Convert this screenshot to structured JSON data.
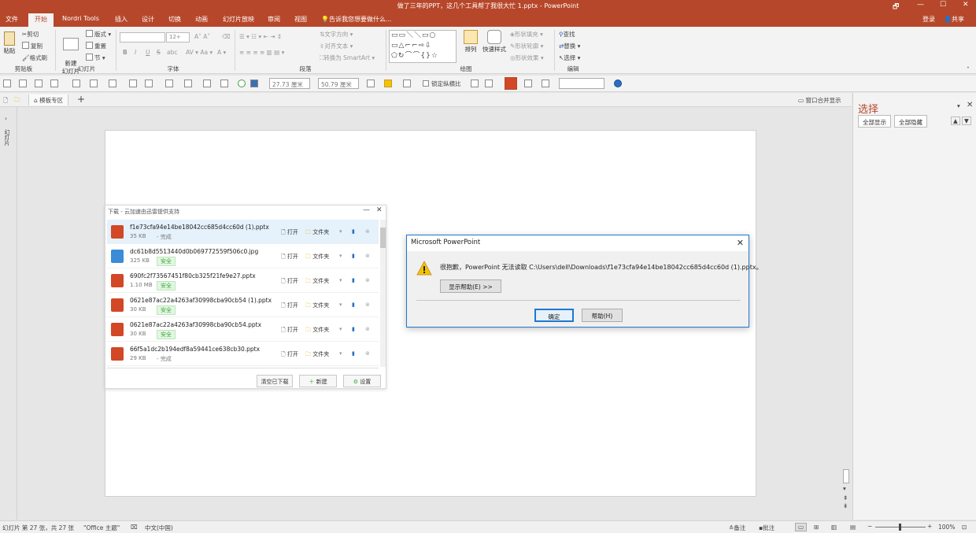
{
  "app": {
    "title": "做了三年的PPT，这几个工具帮了我很大忙 1.pptx - PowerPoint",
    "window_controls": [
      "🗗",
      "—",
      "☐",
      "✕"
    ]
  },
  "tabs": [
    {
      "label": "文件"
    },
    {
      "label": "开始",
      "active": true
    },
    {
      "label": "Nordri Tools"
    },
    {
      "label": "插入"
    },
    {
      "label": "设计"
    },
    {
      "label": "切换"
    },
    {
      "label": "动画"
    },
    {
      "label": "幻灯片放映"
    },
    {
      "label": "审阅"
    },
    {
      "label": "视图"
    }
  ],
  "tell_me": "告诉我您想要做什么...",
  "account": {
    "login": "登录",
    "share": "共享"
  },
  "ribbon": {
    "clipboard": {
      "paste": "粘贴",
      "cut": "剪切",
      "copy": "复制",
      "format_painter": "格式刷",
      "group": "剪贴板"
    },
    "slides": {
      "new_slide": "新建\n幻灯片",
      "layout": "版式",
      "reset": "重置",
      "section": "节",
      "group": "幻灯片"
    },
    "font": {
      "size": "12+",
      "bold": "B",
      "italic": "I",
      "underline": "U",
      "strike": "S",
      "shadow": "abc",
      "group": "字体"
    },
    "paragraph": {
      "text_dir": "文字方向",
      "align_text": "对齐文本",
      "smartart": "转换为 SmartArt",
      "group": "段落"
    },
    "drawing": {
      "arrange": "排列",
      "quick_styles": "快速样式",
      "fill": "形状填充",
      "outline": "形状轮廓",
      "effects": "形状效果",
      "group": "绘图"
    },
    "editing": {
      "find": "查找",
      "replace": "替换",
      "select": "选择",
      "group": "编辑"
    }
  },
  "toolbar2": {
    "width": "27.73 厘米",
    "height": "50.79 厘米",
    "lock_ratio": "锁定纵横比"
  },
  "thumbbar": {
    "template": "模板专区",
    "add": "+",
    "merge": "窗口合并显示"
  },
  "leftrail": {
    "label": "幻灯片"
  },
  "selection_pane": {
    "title": "选择",
    "show_all": "全部显示",
    "hide_all": "全部隐藏"
  },
  "download_panel": {
    "title": "下载 - 云加速由迅雷提供支持",
    "open_label": "打开",
    "folder_label": "文件夹",
    "items": [
      {
        "name": "f1e73cfa94e14be18042cc685d4cc60d (1).pptx",
        "size": "35 KB",
        "status": "- 完成",
        "type": "pptx",
        "safe": false
      },
      {
        "name": "dc61b8d5513440d0b069772559f506c0.jpg",
        "size": "325 KB",
        "status": "安全",
        "type": "jpg",
        "safe": true
      },
      {
        "name": "690fc2f73567451f80cb325f21fe9e27.pptx",
        "size": "1.10 MB",
        "status": "安全",
        "type": "pptx",
        "safe": true
      },
      {
        "name": "0621e87ac22a4263af30998cba90cb54 (1).pptx",
        "size": "30 KB",
        "status": "安全",
        "type": "pptx",
        "safe": true
      },
      {
        "name": "0621e87ac22a4263af30998cba90cb54.pptx",
        "size": "30 KB",
        "status": "安全",
        "type": "pptx",
        "safe": true
      },
      {
        "name": "66f5a1dc2b194edf8a59441ce638cb30.pptx",
        "size": "29 KB",
        "status": "- 完成",
        "type": "pptx",
        "safe": false
      }
    ],
    "clear_label": "清空已下载",
    "new_label": "新建",
    "settings_label": "设置"
  },
  "dialog": {
    "title": "Microsoft PowerPoint",
    "message": "很抱歉，PowerPoint 无法读取 C:\\Users\\dell\\Downloads\\f1e73cfa94e14be18042cc685d4cc60d (1).pptx。",
    "help_toggle": "显示帮助(E) >>",
    "ok": "确定",
    "help": "帮助(H)"
  },
  "statusbar": {
    "slide_info": "幻灯片 第 27 张，共 27 张",
    "theme": "\"Office 主题\"",
    "language": "中文(中国)",
    "notes": "备注",
    "comments": "批注",
    "zoom": "100%"
  },
  "colors": {
    "accent": "#b7472a",
    "ppt_icon": "#d24726",
    "dialog_border": "#1f78d1",
    "warning": "#f3c300"
  }
}
